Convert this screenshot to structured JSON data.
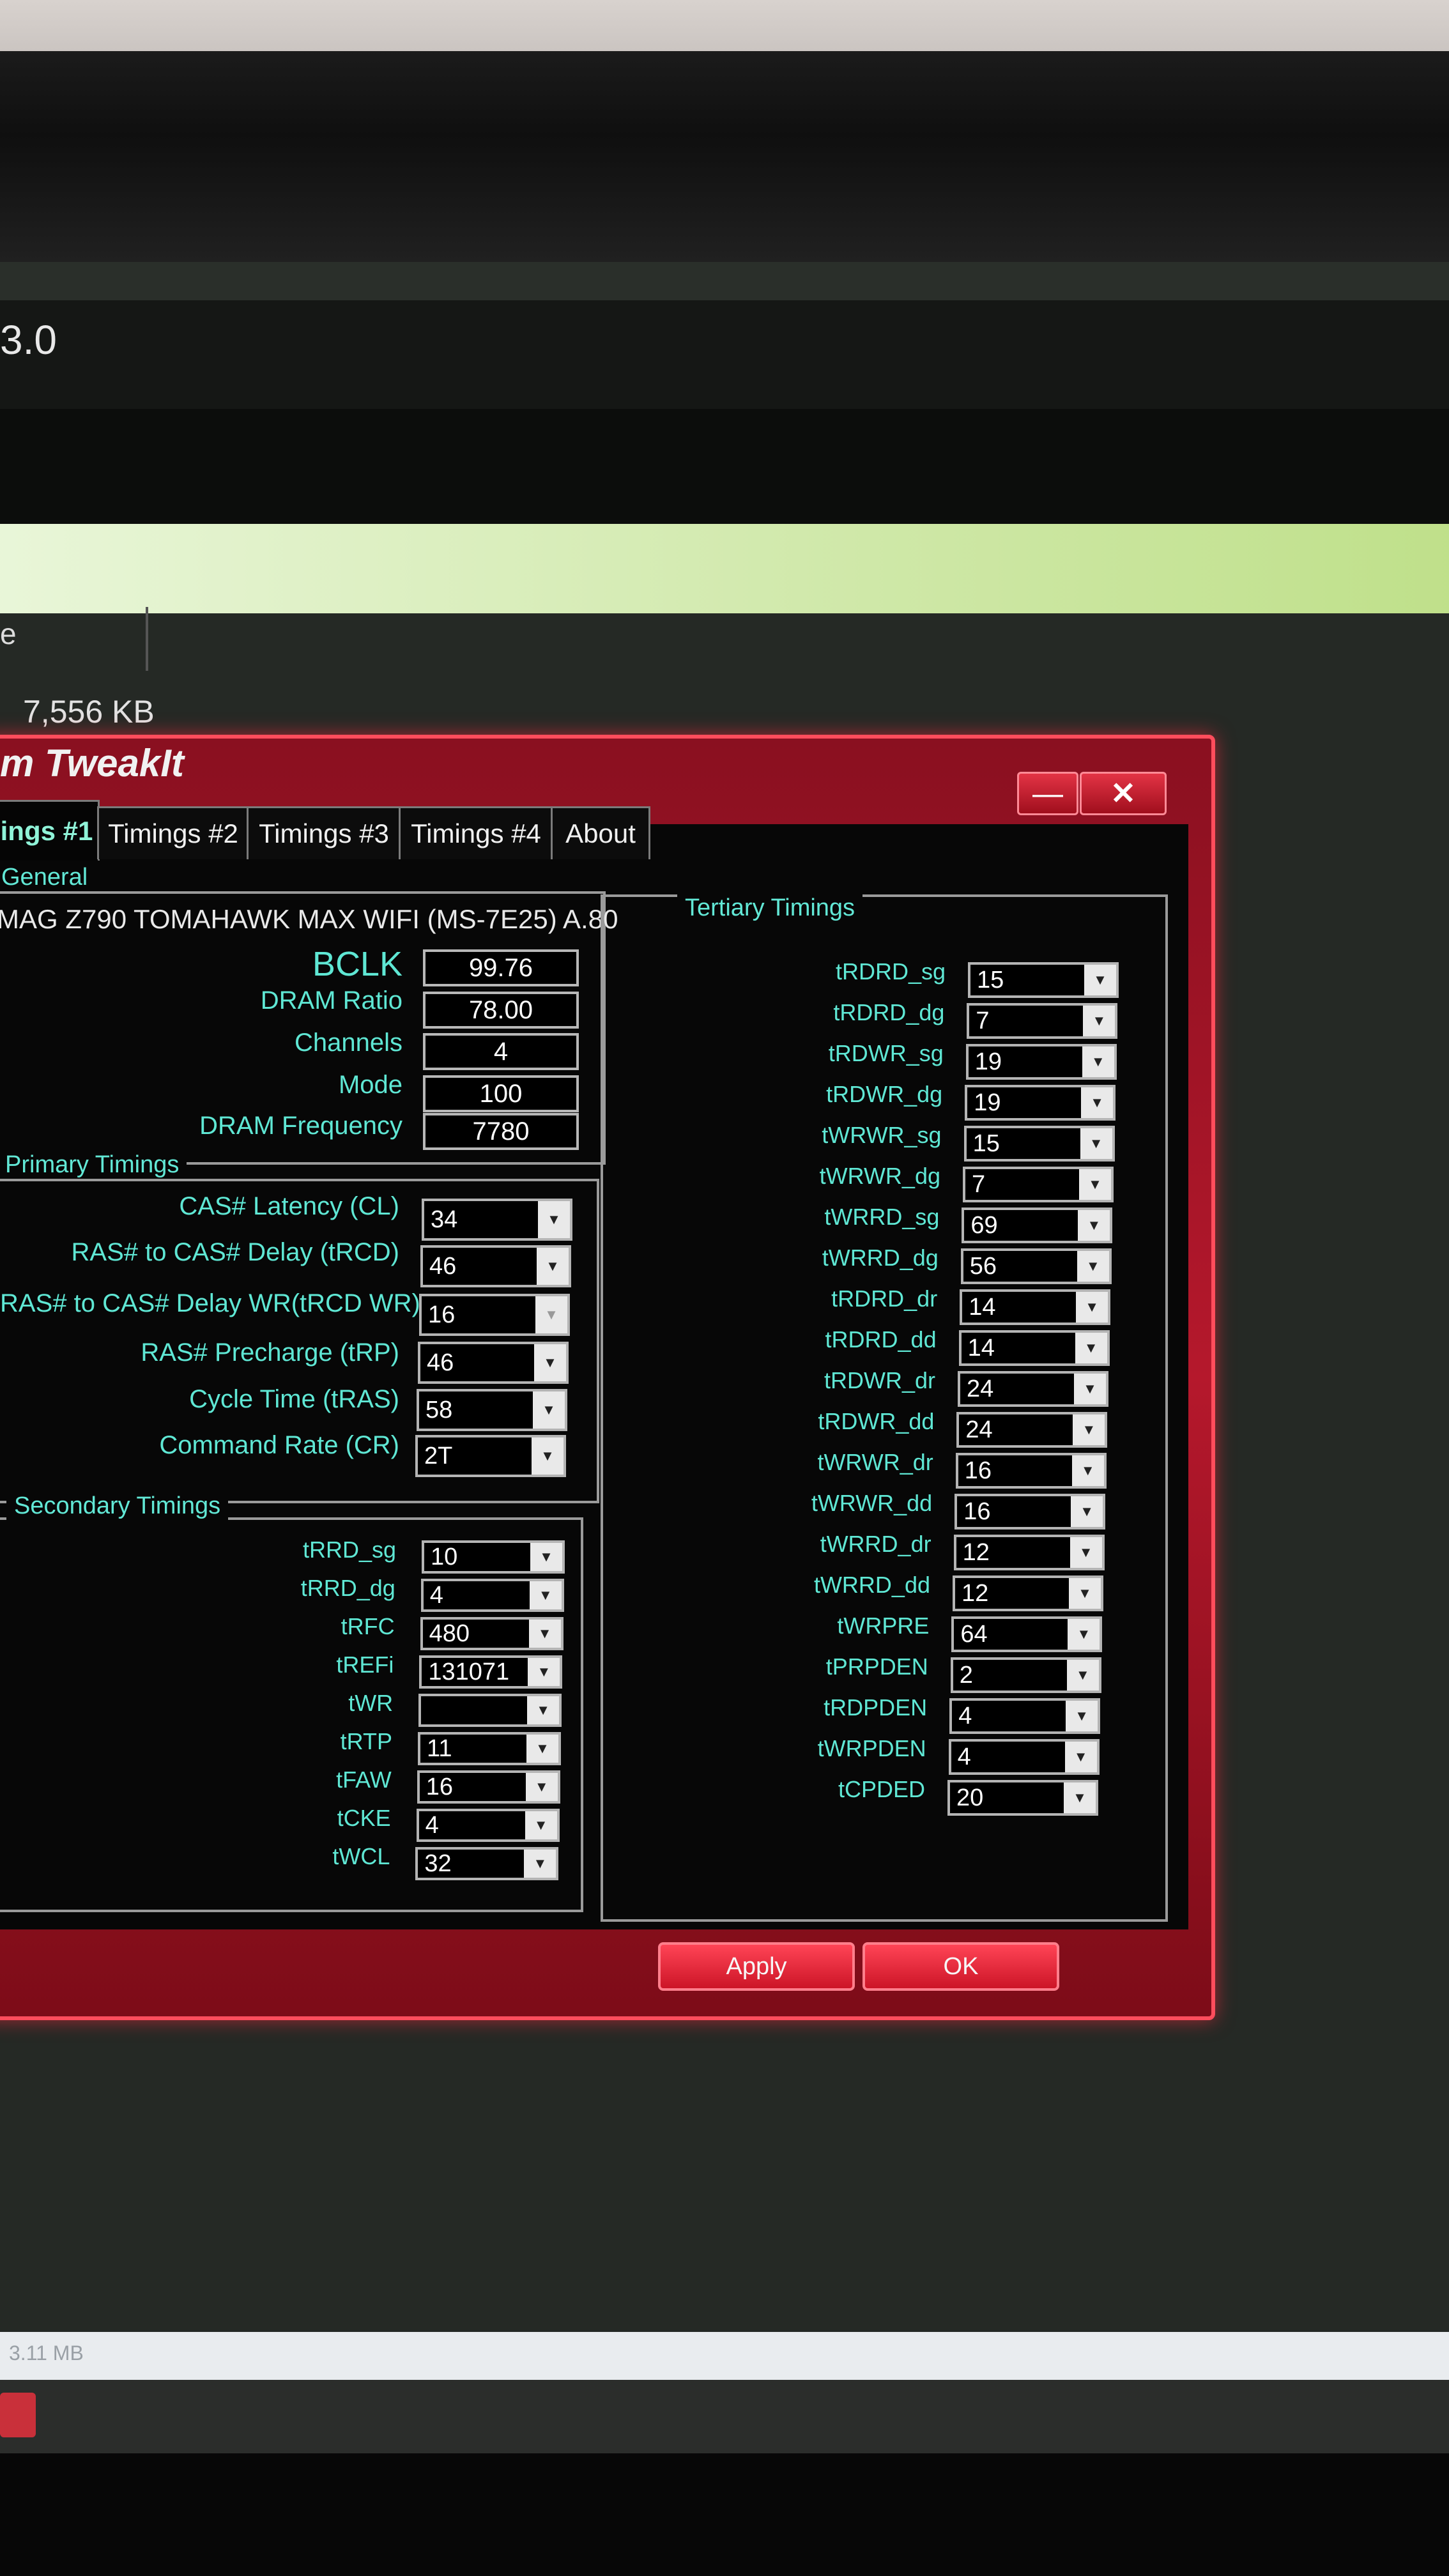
{
  "background": {
    "title_fragment": "3.0",
    "column_fragment": "e",
    "memory_kb": "7,556 KB",
    "status_text": "3.11 MB"
  },
  "window": {
    "title": "m TweakIt",
    "minimize_glyph": "—",
    "close_glyph": "✕",
    "tabs": [
      "ings #1",
      "Timings #2",
      "Timings #3",
      "Timings #4",
      "About"
    ],
    "active_tab": 0
  },
  "general": {
    "group_label": "General",
    "motherboard": "MAG Z790 TOMAHAWK MAX WIFI (MS-7E25) A.80",
    "fields": [
      {
        "label": "BCLK",
        "value": "99.76"
      },
      {
        "label": "DRAM Ratio",
        "value": "78.00"
      },
      {
        "label": "Channels",
        "value": "4"
      },
      {
        "label": "Mode",
        "value": "100"
      },
      {
        "label": "DRAM Frequency",
        "value": "7780"
      }
    ]
  },
  "primary": {
    "group_label": "Primary Timings",
    "fields": [
      {
        "label": "CAS# Latency (CL)",
        "value": "34"
      },
      {
        "label": "RAS# to CAS# Delay (tRCD)",
        "value": "46"
      },
      {
        "label": "RAS# to CAS# Delay WR(tRCD WR)",
        "value": "16"
      },
      {
        "label": "RAS# Precharge (tRP)",
        "value": "46"
      },
      {
        "label": "Cycle Time (tRAS)",
        "value": "58"
      },
      {
        "label": "Command Rate (CR)",
        "value": "2T"
      }
    ]
  },
  "secondary": {
    "group_label": "Secondary Timings",
    "fields": [
      {
        "label": "tRRD_sg",
        "value": "10"
      },
      {
        "label": "tRRD_dg",
        "value": "4"
      },
      {
        "label": "tRFC",
        "value": "480"
      },
      {
        "label": "tREFi",
        "value": "131071"
      },
      {
        "label": "tWR",
        "value": ""
      },
      {
        "label": "tRTP",
        "value": "11"
      },
      {
        "label": "tFAW",
        "value": "16"
      },
      {
        "label": "tCKE",
        "value": "4"
      },
      {
        "label": "tWCL",
        "value": "32"
      }
    ]
  },
  "tertiary": {
    "group_label": "Tertiary Timings",
    "fields": [
      {
        "label": "tRDRD_sg",
        "value": "15"
      },
      {
        "label": "tRDRD_dg",
        "value": "7"
      },
      {
        "label": "tRDWR_sg",
        "value": "19"
      },
      {
        "label": "tRDWR_dg",
        "value": "19"
      },
      {
        "label": "tWRWR_sg",
        "value": "15"
      },
      {
        "label": "tWRWR_dg",
        "value": "7"
      },
      {
        "label": "tWRRD_sg",
        "value": "69"
      },
      {
        "label": "tWRRD_dg",
        "value": "56"
      },
      {
        "label": "tRDRD_dr",
        "value": "14"
      },
      {
        "label": "tRDRD_dd",
        "value": "14"
      },
      {
        "label": "tRDWR_dr",
        "value": "24"
      },
      {
        "label": "tRDWR_dd",
        "value": "24"
      },
      {
        "label": "tWRWR_dr",
        "value": "16"
      },
      {
        "label": "tWRWR_dd",
        "value": "16"
      },
      {
        "label": "tWRRD_dr",
        "value": "12"
      },
      {
        "label": "tWRRD_dd",
        "value": "12"
      },
      {
        "label": "tWRPRE",
        "value": "64"
      },
      {
        "label": "tPRPDEN",
        "value": "2"
      },
      {
        "label": "tRDPDEN",
        "value": "4"
      },
      {
        "label": "tWRPDEN",
        "value": "4"
      },
      {
        "label": "tCPDED",
        "value": "20"
      }
    ]
  },
  "buttons": {
    "apply": "Apply",
    "ok": "OK"
  },
  "icons": {
    "combo_arrow": "▼",
    "dropdown_icon": "chevron-down-icon"
  },
  "colors": {
    "frame_red": "#b5182c",
    "label_cyan": "#5fe7d4",
    "client_bg": "#070707"
  }
}
